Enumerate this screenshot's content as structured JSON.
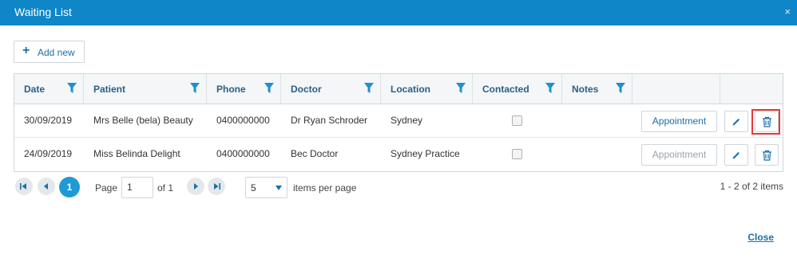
{
  "dialog": {
    "title": "Waiting List",
    "close_icon": "×"
  },
  "toolbar": {
    "add_label": "Add new"
  },
  "grid": {
    "columns": [
      {
        "label": "Date"
      },
      {
        "label": "Patient"
      },
      {
        "label": "Phone"
      },
      {
        "label": "Doctor"
      },
      {
        "label": "Location"
      },
      {
        "label": "Contacted"
      },
      {
        "label": "Notes"
      }
    ],
    "rows": [
      {
        "date": "30/09/2019",
        "patient": "Mrs Belle (bela) Beauty",
        "phone": "0400000000",
        "doctor": "Dr Ryan Schroder",
        "location": "Sydney",
        "contacted": false,
        "notes": "",
        "appointment_label": "Appointment"
      },
      {
        "date": "24/09/2019",
        "patient": "Miss Belinda Delight",
        "phone": "0400000000",
        "doctor": "Bec Doctor",
        "location": "Sydney Practice",
        "contacted": false,
        "notes": "",
        "appointment_label": "Appointment"
      }
    ]
  },
  "pager": {
    "current_page": "1",
    "page_label": "Page",
    "page_value": "1",
    "of_label": "of 1",
    "page_size": "5",
    "page_size_label": "items per page",
    "info": "1 - 2 of 2 items"
  },
  "footer": {
    "close_label": "Close"
  },
  "colors": {
    "header_blue": "#0e86c7",
    "accent": "#1b6fa8",
    "filter_icon": "#1f8fd0",
    "highlight": "#e53935"
  }
}
